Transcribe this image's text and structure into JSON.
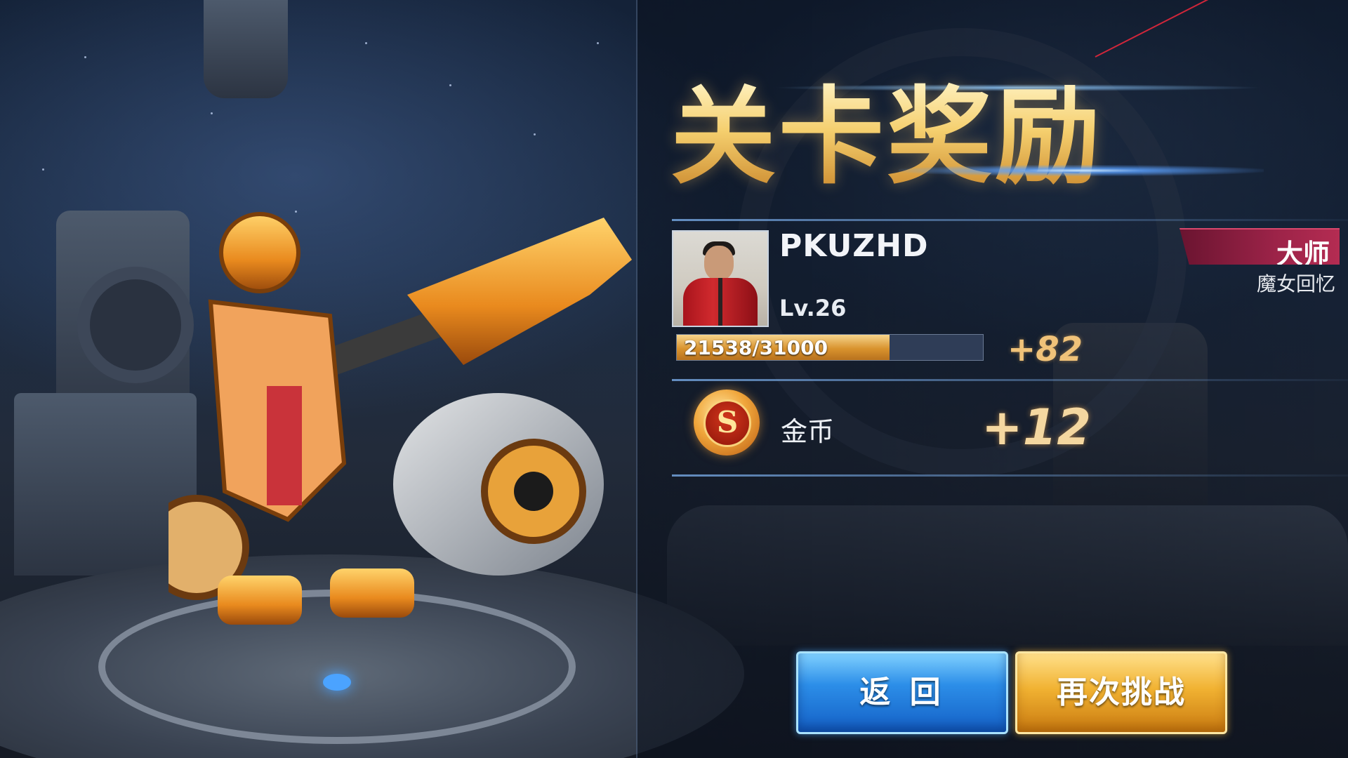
{
  "reward_panel": {
    "title": "关卡奖励",
    "player": {
      "name": "PKUZHD",
      "level": "Lv.26",
      "rank": "大师",
      "rank_subtitle": "魔女回忆"
    },
    "experience": {
      "text": "21538/31000",
      "current": 21538,
      "max": 31000,
      "gain": "+82"
    },
    "coins": {
      "label": "金币",
      "gain": "+12",
      "icon": "coin-icon"
    }
  },
  "buttons": {
    "back": "返 回",
    "retry": "再次挑战"
  },
  "colors": {
    "title_gold": "#f5cf6e",
    "exp_fill": "#d9932e",
    "rank_badge": "#9c2348",
    "back_button": "#2c8ee8",
    "retry_button": "#f1b232"
  }
}
